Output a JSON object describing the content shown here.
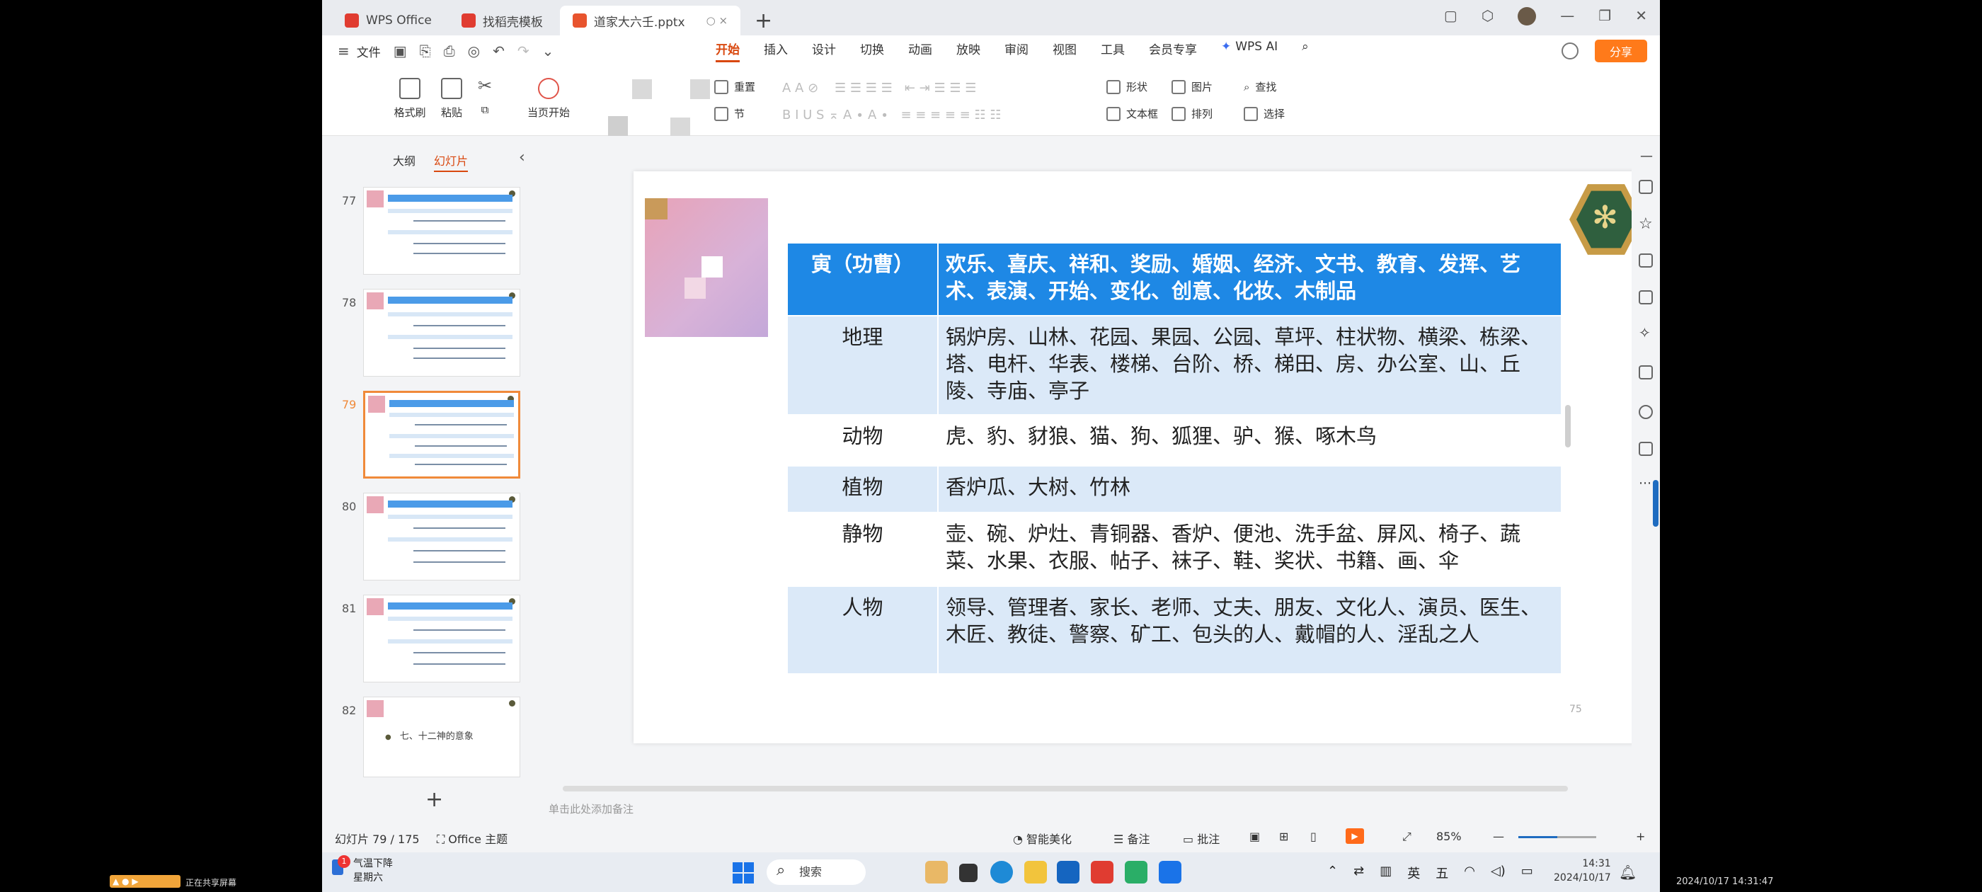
{
  "tabs": [
    {
      "label": "WPS Office",
      "color": "#e03c31"
    },
    {
      "label": "找稻壳模板",
      "color": "#e03c31"
    },
    {
      "label": "道家大六壬.pptx",
      "color": "#e8542e"
    }
  ],
  "menubar": {
    "file_label": "文件",
    "tabs": [
      "开始",
      "插入",
      "设计",
      "切换",
      "动画",
      "放映",
      "审阅",
      "视图",
      "工具",
      "会员专享"
    ],
    "ai_label": "WPS AI",
    "share_label": "分享"
  },
  "ribbon": {
    "format_painter": "格式刷",
    "paste": "粘贴",
    "from_current": "当页开始",
    "reset": "重置",
    "section": "节",
    "shape": "形状",
    "picture": "图片",
    "find": "查找",
    "textbox": "文本框",
    "arrange": "排列",
    "select": "选择"
  },
  "panel": {
    "outline_tab": "大纲",
    "slides_tab": "幻灯片",
    "thumbs": [
      {
        "num": "77"
      },
      {
        "num": "78"
      },
      {
        "num": "79"
      },
      {
        "num": "80"
      },
      {
        "num": "81"
      },
      {
        "num": "82",
        "text": "七、十二神的意象"
      }
    ]
  },
  "slide": {
    "page_num": "75",
    "table": [
      {
        "key": "寅（功曹）",
        "value": "欢乐、喜庆、祥和、奖励、婚姻、经济、文书、教育、发挥、艺术、表演、开始、变化、创意、化妆、木制品"
      },
      {
        "key": "地理",
        "value": "锅炉房、山林、花园、果园、公园、草坪、柱状物、横梁、栋梁、塔、电杆、华表、楼梯、台阶、桥、梯田、房、办公室、山、丘陵、寺庙、亭子"
      },
      {
        "key": "动物",
        "value": "虎、豹、豺狼、猫、狗、狐狸、驴、猴、啄木鸟"
      },
      {
        "key": "植物",
        "value": "香炉瓜、大树、竹林"
      },
      {
        "key": "静物",
        "value": "壶、碗、炉灶、青铜器、香炉、便池、洗手盆、屏风、椅子、蔬菜、水果、衣服、帖子、袜子、鞋、奖状、书籍、画、伞"
      },
      {
        "key": "人物",
        "value": "领导、管理者、家长、老师、丈夫、朋友、文化人、演员、医生、木匠、教徒、警察、矿工、包头的人、戴帽的人、淫乱之人"
      }
    ],
    "notes_hint": "单击此处添加备注"
  },
  "status": {
    "slide_counter": "幻灯片 79 / 175",
    "theme": "Office 主题",
    "beautify": "智能美化",
    "notes": "备注",
    "comment": "批注",
    "zoom": "85%",
    "zoom_fraction": 0.5
  },
  "taskbar": {
    "weather_line1": "气温下降",
    "weather_line2": "星期六",
    "weather_badge": "1",
    "search": "搜索",
    "ime1": "英",
    "ime2": "五",
    "time": "14:31",
    "date": "2024/10/17"
  },
  "overlay": {
    "rec_text": "正在共享屏幕",
    "timestamp": "2024/10/17 14:31:47"
  },
  "colors": {
    "table_header": "#1e88e5",
    "table_shade": "#dbe9f8",
    "accent": "#d9480f",
    "share_button": "#ff7a1a"
  }
}
